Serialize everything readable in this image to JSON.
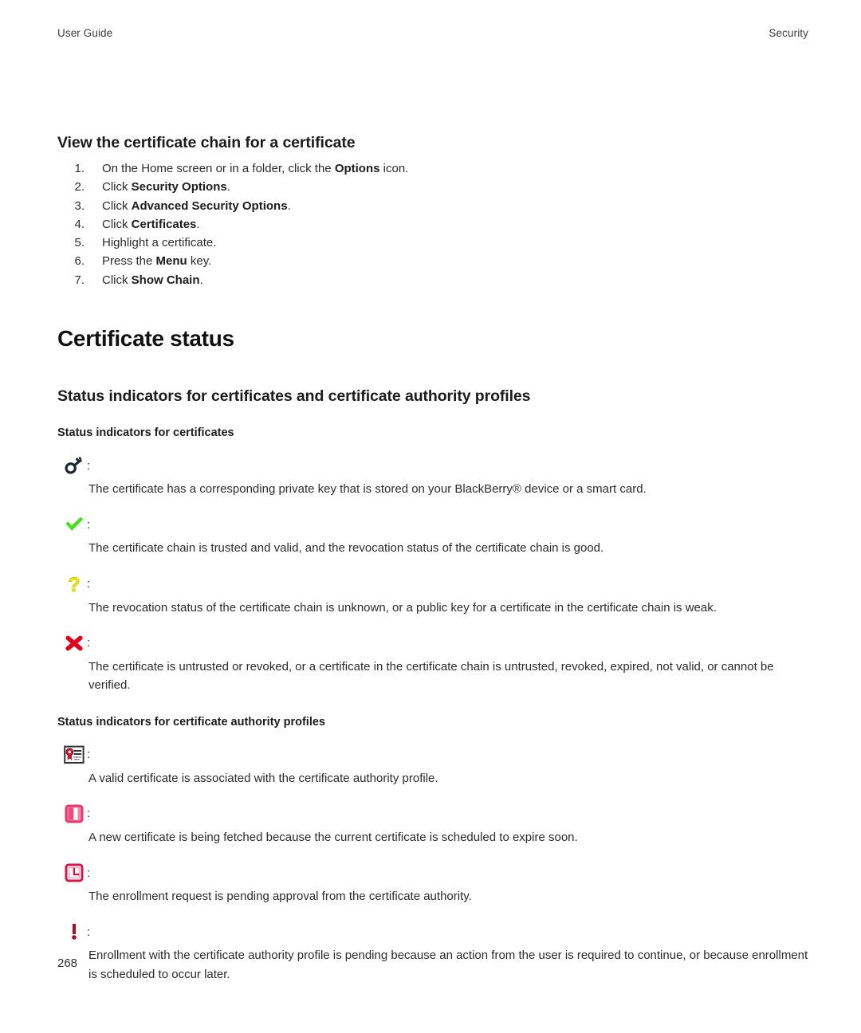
{
  "header": {
    "left": "User Guide",
    "right": "Security"
  },
  "section": {
    "title": "View the certificate chain for a certificate",
    "steps": [
      {
        "num": "1.",
        "before": "On the Home screen or in a folder, click the ",
        "bold": "Options",
        "after": " icon."
      },
      {
        "num": "2.",
        "before": "Click ",
        "bold": "Security Options",
        "after": "."
      },
      {
        "num": "3.",
        "before": "Click ",
        "bold": "Advanced Security Options",
        "after": "."
      },
      {
        "num": "4.",
        "before": "Click ",
        "bold": "Certificates",
        "after": "."
      },
      {
        "num": "5.",
        "before": "Highlight a certificate.",
        "bold": "",
        "after": ""
      },
      {
        "num": "6.",
        "before": "Press the ",
        "bold": "Menu",
        "after": " key."
      },
      {
        "num": "7.",
        "before": "Click ",
        "bold": "Show Chain",
        "after": "."
      }
    ]
  },
  "chapter": {
    "title": "Certificate status"
  },
  "topic": {
    "title": "Status indicators for certificates and certificate authority profiles"
  },
  "certificates": {
    "subtitle": "Status indicators for certificates",
    "items": [
      {
        "icon": "key-icon",
        "colon": ":",
        "description": "The certificate has a corresponding private key that is stored on your BlackBerry® device or a smart card."
      },
      {
        "icon": "green-check-icon",
        "colon": ":",
        "description": "The certificate chain is trusted and valid, and the revocation status of the certificate chain is good."
      },
      {
        "icon": "yellow-question-mark-icon",
        "colon": ":",
        "description": "The revocation status of the certificate chain is unknown, or a public key for a certificate in the certificate chain is weak."
      },
      {
        "icon": "red-x-icon",
        "colon": ":",
        "description": "The certificate is untrusted or revoked, or a certificate in the certificate chain is untrusted, revoked, expired, not valid, or cannot be verified."
      }
    ]
  },
  "authority_profiles": {
    "subtitle": "Status indicators for certificate authority profiles",
    "items": [
      {
        "icon": "certificate-seal-icon",
        "colon": ":",
        "description": "A valid certificate is associated with the certificate authority profile."
      },
      {
        "icon": "fetching-certificate-icon",
        "colon": ":",
        "description": "A new certificate is being fetched because the current certificate is scheduled to expire soon."
      },
      {
        "icon": "pending-clock-icon",
        "colon": ":",
        "description": "The enrollment request is pending approval from the certificate authority."
      },
      {
        "icon": "red-exclamation-icon",
        "colon": ":",
        "description": "Enrollment with the certificate authority profile is pending because an action from the user is required to continue, or because enrollment is scheduled to occur later."
      }
    ]
  },
  "footer": {
    "page_number": "268"
  },
  "colors": {
    "key": "#1b2430",
    "check_green": "#46dd1e",
    "question_yellow": "#e6e600",
    "x_red": "#e2001a",
    "seal_red": "#cc1133",
    "fetch_pink": "#e5396f",
    "pending_pink": "#d6154b",
    "exclaim_red": "#a81020"
  }
}
